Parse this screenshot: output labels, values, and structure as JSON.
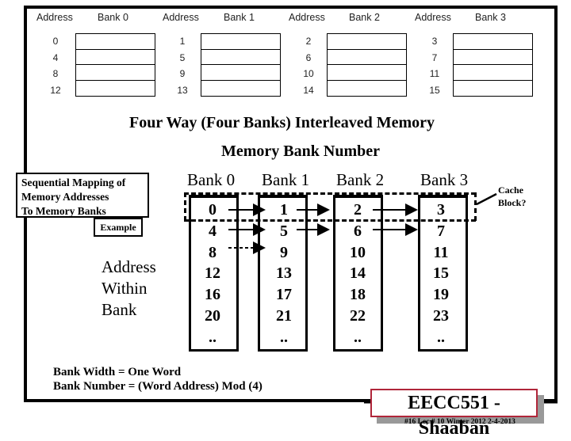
{
  "top_figure": {
    "headers": [
      {
        "address": "Address",
        "bank": "Bank 0"
      },
      {
        "address": "Address",
        "bank": "Bank 1"
      },
      {
        "address": "Address",
        "bank": "Bank 2"
      },
      {
        "address": "Address",
        "bank": "Bank 3"
      }
    ],
    "banks": [
      {
        "addresses": [
          "0",
          "4",
          "8",
          "12"
        ]
      },
      {
        "addresses": [
          "1",
          "5",
          "9",
          "13"
        ]
      },
      {
        "addresses": [
          "2",
          "6",
          "10",
          "14"
        ]
      },
      {
        "addresses": [
          "3",
          "7",
          "11",
          "15"
        ]
      }
    ]
  },
  "title": "Four Way (Four Banks) Interleaved Memory",
  "subtitle": "Memory Bank Number",
  "callout": {
    "lines": [
      "Sequential Mapping of",
      "Memory Addresses",
      "To Memory Banks"
    ],
    "example_label": "Example"
  },
  "address_within_bank": [
    "Address",
    "Within",
    "Bank"
  ],
  "banks": [
    {
      "label": "Bank 0",
      "values": [
        "0",
        "4",
        "8",
        "12",
        "16",
        "20",
        ".."
      ]
    },
    {
      "label": "Bank 1",
      "values": [
        "1",
        "5",
        "9",
        "13",
        "17",
        "21",
        ".."
      ]
    },
    {
      "label": "Bank 2",
      "values": [
        "2",
        "6",
        "10",
        "14",
        "18",
        "22",
        ".."
      ]
    },
    {
      "label": "Bank 3",
      "values": [
        "3",
        "7",
        "11",
        "15",
        "19",
        "23",
        ".."
      ]
    }
  ],
  "cache_block_label": [
    "Cache",
    "Block?"
  ],
  "notes": [
    "Bank Width = One Word",
    "Bank Number = (Word Address) Mod (4)"
  ],
  "brand": "EECC551 - Shaaban",
  "footer": "#16   Lec # 10 Winter 2012  2-4-2013",
  "colors": {
    "brand_border": "#b0263a",
    "shadow": "#999999"
  }
}
